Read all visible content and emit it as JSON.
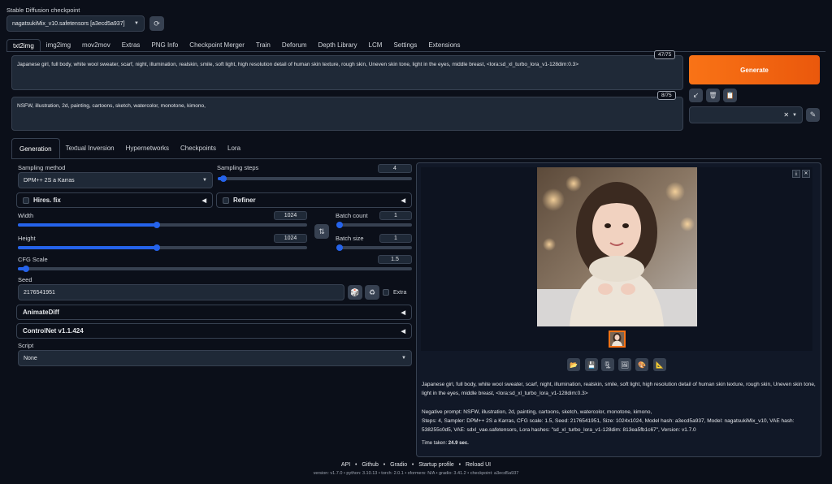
{
  "checkpoint": {
    "label": "Stable Diffusion checkpoint",
    "value": "nagatsukiMix_v10.safetensors [a3ecd5a937]"
  },
  "main_tabs": [
    "txt2img",
    "img2img",
    "mov2mov",
    "Extras",
    "PNG Info",
    "Checkpoint Merger",
    "Train",
    "Deforum",
    "Depth Library",
    "LCM",
    "Settings",
    "Extensions"
  ],
  "prompt": {
    "text": "Japanese girl, full body, white wool sweater, scarf,  night, illumination, realskin, smile, soft light, high resolution detail of human skin texture, rough skin, Uneven skin tone, light in the eyes,  middle breast, <lora:sd_xl_turbo_lora_v1-128dim:0.3>",
    "counter": "47/75"
  },
  "negative_prompt": {
    "text": "NSFW, illustration, 2d, painting, cartoons, sketch, watercolor, monotone, kimono,",
    "counter": "8/75"
  },
  "generate_label": "Generate",
  "sub_tabs": [
    "Generation",
    "Textual Inversion",
    "Hypernetworks",
    "Checkpoints",
    "Lora"
  ],
  "sampling": {
    "method_label": "Sampling method",
    "method_value": "DPM++ 2S a Karras",
    "steps_label": "Sampling steps",
    "steps_value": "4",
    "steps_fraction": 0.03
  },
  "hires_label": "Hires. fix",
  "refiner_label": "Refiner",
  "width": {
    "label": "Width",
    "value": "1024",
    "fraction": 0.48
  },
  "height": {
    "label": "Height",
    "value": "1024",
    "fraction": 0.48
  },
  "batch_count": {
    "label": "Batch count",
    "value": "1",
    "fraction": 0.0
  },
  "batch_size": {
    "label": "Batch size",
    "value": "1",
    "fraction": 0.0
  },
  "cfg": {
    "label": "CFG Scale",
    "value": "1.5",
    "fraction": 0.02
  },
  "seed": {
    "label": "Seed",
    "value": "2176541951",
    "extra_label": "Extra"
  },
  "animatediff_label": "AnimateDiff",
  "controlnet_label": "ControlNet v1.1.424",
  "script": {
    "label": "Script",
    "value": "None"
  },
  "info": {
    "prompt": "Japanese girl, full body, white wool sweater, scarf, night, illumination, realskin, smile, soft light, high resolution detail of human skin texture, rough skin, Uneven skin tone, light in the eyes, middle breast, <lora:sd_xl_turbo_lora_v1-128dim:0.3>",
    "negative": "Negative prompt: NSFW, illustration, 2d, painting, cartoons, sketch, watercolor, monotone, kimono,",
    "params": "Steps: 4, Sampler: DPM++ 2S a Karras, CFG scale: 1.5, Seed: 2176541951, Size: 1024x1024, Model hash: a3ecd5a937, Model: nagatsukiMix_v10, VAE hash: 538255c0d5, VAE: sdxl_vae.safetensors, Lora hashes: \"sd_xl_turbo_lora_v1-128dim: 813ea5fb1c67\", Version: v1.7.0",
    "time_prefix": "Time taken: ",
    "time_value": "24.9 sec."
  },
  "footer": {
    "links": [
      "API",
      "Github",
      "Gradio",
      "Startup profile",
      "Reload UI"
    ],
    "version": "version: v1.7.0  •  python: 3.10.13  •  torch: 2.0.1  •  xformers: N/A  •  gradio: 3.41.2  •  checkpoint: a3ecd5a937"
  },
  "colors": {
    "accent": "#ea580c",
    "slider": "#2563eb",
    "bg": "#0b0f19"
  }
}
